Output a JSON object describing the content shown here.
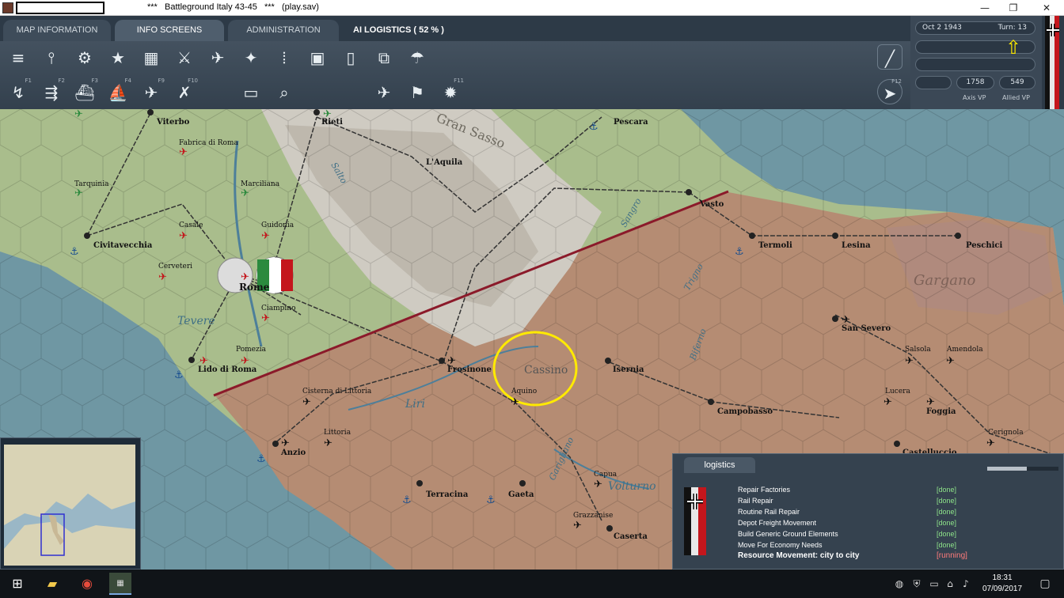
{
  "window": {
    "title": "***   Battleground Italy 43-45   ***   (play.sav)",
    "minimize_glyph": "—",
    "restore_glyph": "❐",
    "close_glyph": "✕"
  },
  "tabs": [
    {
      "label": "MAP INFORMATION"
    },
    {
      "label": "INFO SCREENS"
    },
    {
      "label": "ADMINISTRATION"
    },
    {
      "label": "AI LOGISTICS   ( 52 % )"
    }
  ],
  "status": {
    "date": "Oct 2 1943",
    "turn": "Turn: 13",
    "axis_vp": "1758",
    "allied_vp": "549",
    "axis_vp_label": "Axis VP",
    "allied_vp_label": "Allied VP"
  },
  "toolbar1": [
    {
      "icon": "layers-icon",
      "glyph": "≡"
    },
    {
      "icon": "units-icon",
      "glyph": "⫯"
    },
    {
      "icon": "gear-icon",
      "glyph": "⚙"
    },
    {
      "icon": "star-icon",
      "glyph": "★"
    },
    {
      "icon": "factory-icon",
      "glyph": "▦"
    },
    {
      "icon": "crossed-swords-icon",
      "glyph": "⚔"
    },
    {
      "icon": "aircraft-icon",
      "glyph": "✈"
    },
    {
      "icon": "satellite-icon",
      "glyph": "✦"
    },
    {
      "icon": "bars-icon",
      "glyph": "⦙"
    },
    {
      "icon": "fuel-icon",
      "glyph": "▣"
    },
    {
      "icon": "phone-icon",
      "glyph": "▯"
    },
    {
      "icon": "graph-icon",
      "glyph": "⧉"
    },
    {
      "icon": "parachute-icon",
      "glyph": "☂"
    }
  ],
  "toolbar2": [
    {
      "icon": "move-icon",
      "glyph": "↯",
      "fkey": "F1"
    },
    {
      "icon": "rail-icon",
      "glyph": "⇶",
      "fkey": "F2"
    },
    {
      "icon": "ship-icon",
      "glyph": "⛴",
      "fkey": "F3"
    },
    {
      "icon": "fleet-icon",
      "glyph": "⛵",
      "fkey": "F4"
    },
    {
      "icon": "air-strike-icon",
      "glyph": "✈",
      "fkey": "F9"
    },
    {
      "icon": "bomb-icon",
      "glyph": "✗",
      "fkey": "F10"
    },
    {
      "icon": "rectangle-icon",
      "glyph": "▭",
      "fkey": ""
    },
    {
      "icon": "zoom-icon",
      "glyph": "⌕",
      "fkey": ""
    },
    {
      "icon": "ai-icon",
      "glyph": "✈",
      "fkey": ""
    },
    {
      "icon": "flag-icon",
      "glyph": "⚑",
      "fkey": ""
    },
    {
      "icon": "explosion-icon",
      "glyph": "✹",
      "fkey": "F11"
    }
  ],
  "map_labels": [
    {
      "text": "Viterbo",
      "kind": "city"
    },
    {
      "text": "Rieti",
      "kind": "city"
    },
    {
      "text": "Pescara",
      "kind": "city"
    },
    {
      "text": "Fabrica di Roma",
      "kind": "town"
    },
    {
      "text": "L'Aquila",
      "kind": "city"
    },
    {
      "text": "Gran Sasso",
      "kind": "region"
    },
    {
      "text": "Tarquinia",
      "kind": "town"
    },
    {
      "text": "Marciliana",
      "kind": "town"
    },
    {
      "text": "Vasto",
      "kind": "city"
    },
    {
      "text": "Casale",
      "kind": "town"
    },
    {
      "text": "Guidonia",
      "kind": "town"
    },
    {
      "text": "Civitavecchia",
      "kind": "city"
    },
    {
      "text": "Termoli",
      "kind": "city"
    },
    {
      "text": "Lesina",
      "kind": "city"
    },
    {
      "text": "Peschici",
      "kind": "city"
    },
    {
      "text": "Cerveteri",
      "kind": "town"
    },
    {
      "text": "Rome",
      "kind": "capital"
    },
    {
      "text": "Gargano",
      "kind": "region"
    },
    {
      "text": "Ciampino",
      "kind": "town"
    },
    {
      "text": "Tevere",
      "kind": "river"
    },
    {
      "text": "San Severo",
      "kind": "city"
    },
    {
      "text": "Pomezia",
      "kind": "town"
    },
    {
      "text": "Salsola",
      "kind": "town"
    },
    {
      "text": "Amendola",
      "kind": "town"
    },
    {
      "text": "Lido di Roma",
      "kind": "city"
    },
    {
      "text": "Frosinone",
      "kind": "city"
    },
    {
      "text": "Cassino",
      "kind": "region"
    },
    {
      "text": "Isernia",
      "kind": "city"
    },
    {
      "text": "Cisterna di Littoria",
      "kind": "town"
    },
    {
      "text": "Aquino",
      "kind": "town"
    },
    {
      "text": "Lucera",
      "kind": "town"
    },
    {
      "text": "Foggia",
      "kind": "city"
    },
    {
      "text": "Liri",
      "kind": "river"
    },
    {
      "text": "Campobasso",
      "kind": "city"
    },
    {
      "text": "Littoria",
      "kind": "town"
    },
    {
      "text": "Cerignola",
      "kind": "town"
    },
    {
      "text": "Anzio",
      "kind": "city"
    },
    {
      "text": "Capua",
      "kind": "town"
    },
    {
      "text": "Volturno",
      "kind": "river"
    },
    {
      "text": "Terracina",
      "kind": "city"
    },
    {
      "text": "Gaeta",
      "kind": "city"
    },
    {
      "text": "Grazzanise",
      "kind": "town"
    },
    {
      "text": "Caserta",
      "kind": "city"
    },
    {
      "text": "Castelluccio",
      "kind": "city"
    },
    {
      "text": "Sangro",
      "kind": "river"
    },
    {
      "text": "Trigno",
      "kind": "river"
    },
    {
      "text": "Biferno",
      "kind": "river"
    },
    {
      "text": "Garigliano",
      "kind": "river"
    },
    {
      "text": "Salto",
      "kind": "river"
    }
  ],
  "logistics": {
    "tab_label": "logistics",
    "progress": 0.55,
    "rows": [
      {
        "label": "Repair Factories",
        "status": "[done]"
      },
      {
        "label": "Rail Repair",
        "status": "[done]"
      },
      {
        "label": "Routine Rail Repair",
        "status": "[done]"
      },
      {
        "label": "Depot Freight Movement",
        "status": "[done]"
      },
      {
        "label": "Build Generic Ground Elements",
        "status": "[done]"
      },
      {
        "label": "Move For Economy Needs",
        "status": "[done]"
      },
      {
        "label": "Resource Movement: city to city",
        "status": "[running]"
      }
    ]
  },
  "taskbar": {
    "time": "18:31",
    "date": "07/09/2017"
  },
  "colors": {
    "sea": "#6f97a3",
    "land_axis": "#a9bd8c",
    "land_allied": "#b58c73",
    "mountain": "#c9c5b8",
    "front_line": "#8b1a2a",
    "highlight": "#ffea00",
    "done": "#8fe58a",
    "running": "#ff7b7b"
  }
}
